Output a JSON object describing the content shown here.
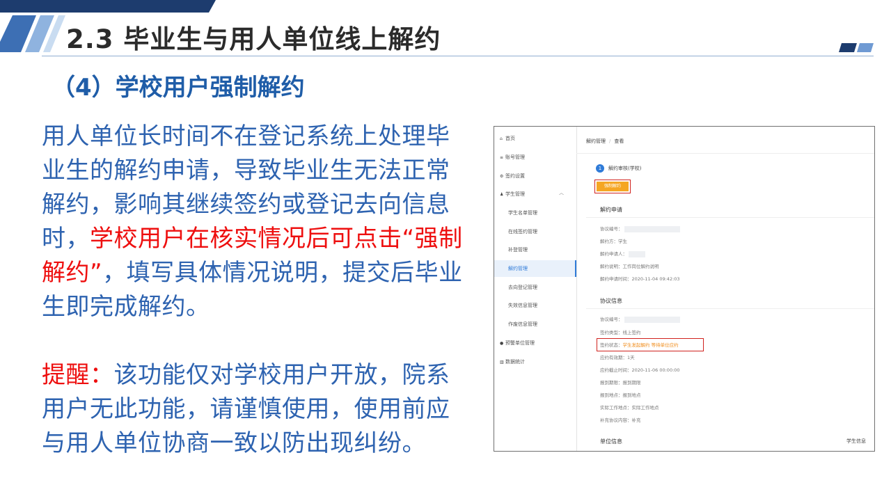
{
  "header": {
    "title": "2.3 毕业生与用人单位线上解约",
    "subtitle": "（4）学校用户强制解约"
  },
  "body": {
    "para1_a": "用人单位长时间不在登记系统上处理毕业生的解约申请，导致毕业生无法正常解约，影响其继续签约或登记去向信息时，",
    "para1_red": "学校用户在核实情况后可点击“强制解约”",
    "para1_b": "，填写具体情况说明，提交后毕业生即完成解约。",
    "para2_red": "提醒：",
    "para2_b": "该功能仅对学校用户开放，院系用户无此功能，请谨慎使用，使用前应与用人单位协商一致以防出现纠纷。"
  },
  "screenshot": {
    "sidebar": {
      "items": [
        {
          "icon": "home-icon",
          "glyph": "⌂",
          "label": "首页"
        },
        {
          "icon": "account-icon",
          "glyph": "≡",
          "label": "账号管理"
        },
        {
          "icon": "settings-icon",
          "glyph": "⚙",
          "label": "签约设置"
        },
        {
          "icon": "student-icon",
          "glyph": "♟",
          "label": "学生管理"
        }
      ],
      "subitems": [
        "学生名单管理",
        "在线签约管理",
        "补登管理",
        "解约管理",
        "去向登记管理",
        "失效信息管理",
        "作废信息管理"
      ],
      "items2": [
        {
          "icon": "alert-icon",
          "glyph": "●",
          "label": "预警单位管理"
        },
        {
          "icon": "chart-icon",
          "glyph": "▥",
          "label": "数据统计"
        }
      ]
    },
    "breadcrumb": {
      "parent": "解约管理",
      "current": "查看"
    },
    "step": {
      "num": "1",
      "label": "解约审核(学校)"
    },
    "force_button": "强制解约",
    "section1": {
      "title": "解约申请",
      "fields": {
        "agreement_no": "协议编号：",
        "party": "解约方：学生",
        "applicant": "解约申请人：",
        "reason": "解约说明：工作岗位解约说明",
        "time": "解约申请时间：2020-11-04 09:42:03"
      }
    },
    "section2": {
      "title": "协议信息",
      "fields": {
        "agreement_no": "协议编号：",
        "type": "签约类型：线上签约",
        "status_label": "签约状态：",
        "status_value": "学生发起解约 等待单位应约",
        "valid": "应约有效期：1天",
        "deadline": "应约截止时间：2020-11-06 00:00:00",
        "report_deadline": "报到期限：报到期限",
        "report_place": "报到地点：报到地点",
        "work_place": "实际工作地点：实际工作地点",
        "extra": "补充协议内容：补充"
      }
    },
    "section3": {
      "title": "单位信息",
      "right": "学生信息"
    }
  },
  "colors": {
    "accent": "#1f5da8",
    "body_blue": "#2e63b0",
    "highlight_red": "#ee0f0f",
    "button_orange": "#f5a623"
  }
}
